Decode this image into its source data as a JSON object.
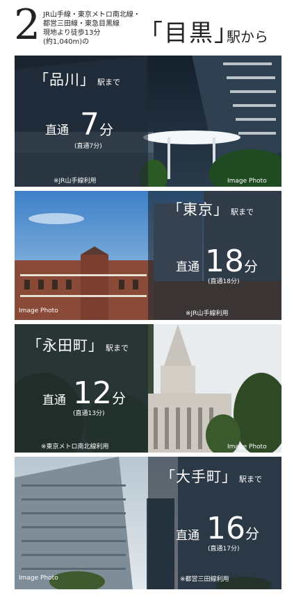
{
  "header": {
    "number": "2",
    "line1": "JR山手線・東京メトロ南北線・",
    "line2": "都営三田線・東急目黒線",
    "line3": "現地より徒歩13分",
    "line4": "(約1,040m)の",
    "station": "「目黒」",
    "suffix": "駅から"
  },
  "panels": [
    {
      "station": "「品川」",
      "made": "駅まで",
      "direct": "直通",
      "minutes": "7",
      "fun": "分",
      "sub": "(直通7分)",
      "note": "※JR山手線利用",
      "photo": "Image Photo"
    },
    {
      "station": "「東京」",
      "made": "駅まで",
      "direct": "直通",
      "minutes": "18",
      "fun": "分",
      "sub": "(直通18分)",
      "note": "※JR山手線利用",
      "photo": "Image Photo"
    },
    {
      "station": "「永田町」",
      "made": "駅まで",
      "direct": "直通",
      "minutes": "12",
      "fun": "分",
      "sub": "(直通13分)",
      "note": "※東京メトロ南北線利用",
      "photo": "Image Photo"
    },
    {
      "station": "「大手町」",
      "made": "駅まで",
      "direct": "直通",
      "minutes": "16",
      "fun": "分",
      "sub": "(直通17分)",
      "note": "※都営三田線利用",
      "photo": "Image Photo"
    }
  ]
}
